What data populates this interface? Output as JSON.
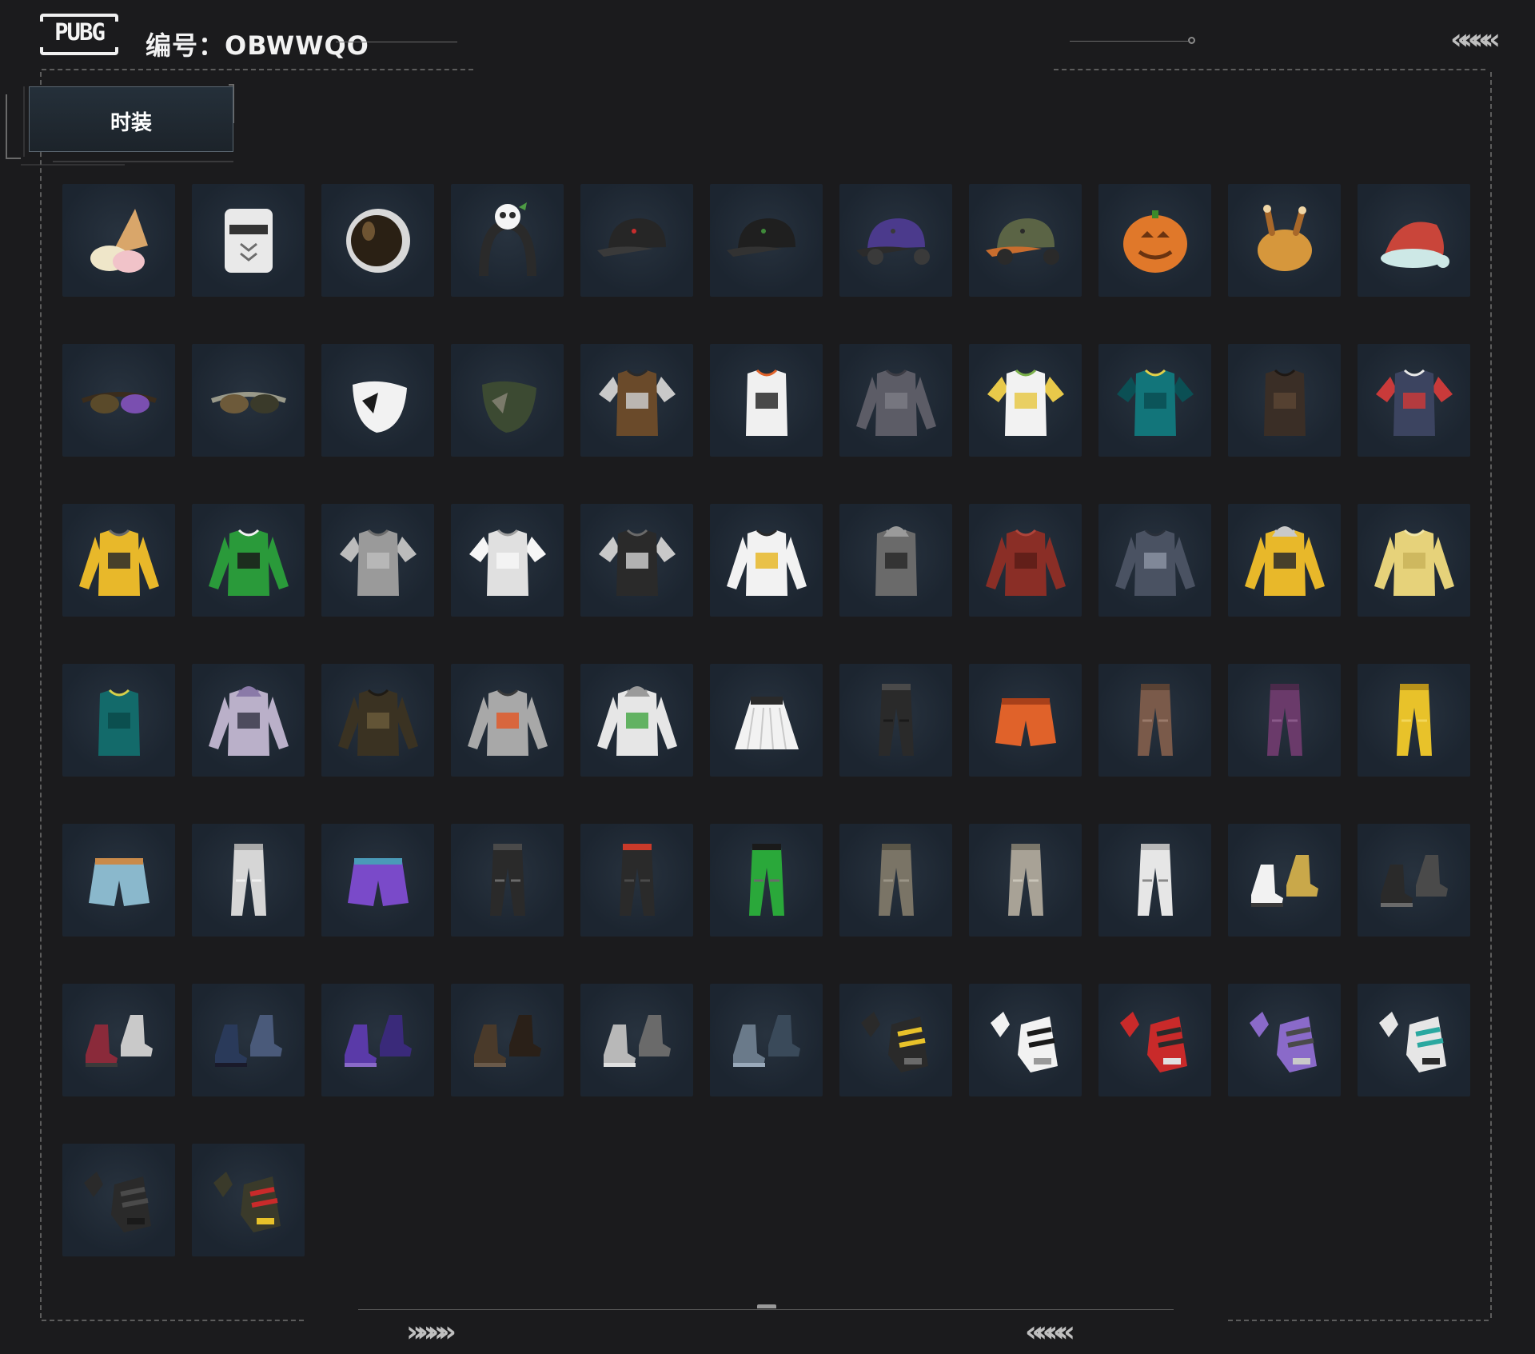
{
  "header": {
    "logo_text": "PUBG",
    "account_label": "编号：OBWWQO"
  },
  "decor": {
    "chevrons_right": "»»»»",
    "chevrons_left": "««««"
  },
  "tabs": [
    {
      "label": "时装",
      "active": true
    }
  ],
  "items": [
    {
      "icon": "ice-cream-hat-icon",
      "colors": [
        "#d9a66a",
        "#f1c3c9",
        "#efe6c9"
      ]
    },
    {
      "icon": "white-helmet-icon",
      "colors": [
        "#e9e9e9",
        "#6c6c6c",
        "#333333"
      ]
    },
    {
      "icon": "astronaut-helmet-icon",
      "colors": [
        "#d8d8d8",
        "#2a2014",
        "#8b6b3e"
      ]
    },
    {
      "icon": "panda-headband-icon",
      "colors": [
        "#2a2a2a",
        "#f5f5f5",
        "#4d9a44"
      ]
    },
    {
      "icon": "black-cap-red-icon",
      "colors": [
        "#262626",
        "#c72d2d",
        "#3a3a3a"
      ]
    },
    {
      "icon": "black-cap-green-icon",
      "colors": [
        "#1f1f1f",
        "#3f8a3a",
        "#323232"
      ]
    },
    {
      "icon": "purple-cap-headset-icon",
      "colors": [
        "#4b3a8c",
        "#3a3a3a",
        "#2b2b2b"
      ]
    },
    {
      "icon": "olive-cap-headset-icon",
      "colors": [
        "#5b6445",
        "#2a2a2a",
        "#c86d2e"
      ]
    },
    {
      "icon": "pumpkin-head-icon",
      "colors": [
        "#e0782a",
        "#6a3310",
        "#3b8a2a"
      ]
    },
    {
      "icon": "roast-chicken-hat-icon",
      "colors": [
        "#d6973c",
        "#a8682a",
        "#f0d6a6"
      ]
    },
    {
      "icon": "santa-hat-icon",
      "colors": [
        "#c9453a",
        "#cde8e6",
        "#e3c170"
      ]
    },
    {
      "icon": "steampunk-goggles-icon",
      "colors": [
        "#5a4a2a",
        "#7a4fb0",
        "#3a2c1c"
      ]
    },
    {
      "icon": "sunglasses-icon",
      "colors": [
        "#6d5a3a",
        "#3a3a2a",
        "#9a9a8a"
      ]
    },
    {
      "icon": "face-mask-icon",
      "colors": [
        "#f2f2f2",
        "#1a1a1a",
        "#b5b5b5"
      ]
    },
    {
      "icon": "camo-bandana-icon",
      "colors": [
        "#3c4a32",
        "#7a7a6a",
        "#2a3224"
      ]
    },
    {
      "icon": "leopard-top-icon",
      "colors": [
        "#6a4a2a",
        "#c9c9c9",
        "#2a2a2a"
      ]
    },
    {
      "icon": "striped-crop-top-icon",
      "colors": [
        "#f0f0f0",
        "#2a2a2a",
        "#e0622a"
      ]
    },
    {
      "icon": "gray-shirt-icon",
      "colors": [
        "#5c5c66",
        "#7a7a84",
        "#3c3c44"
      ]
    },
    {
      "icon": "yellow-white-tee-icon",
      "colors": [
        "#f2f2f2",
        "#e8c94a",
        "#7bb04a"
      ]
    },
    {
      "icon": "teal-polo-icon",
      "colors": [
        "#12757a",
        "#0b4f54",
        "#e0d04a"
      ]
    },
    {
      "icon": "brown-vest-top-icon",
      "colors": [
        "#3a2e26",
        "#5a4434",
        "#1e1814"
      ]
    },
    {
      "icon": "navy-graphic-tee-icon",
      "colors": [
        "#3c4460",
        "#c93a3a",
        "#e8e8e8"
      ]
    },
    {
      "icon": "pubg-striped-jersey-icon",
      "colors": [
        "#e8b82a",
        "#2a2a2a",
        "#6a6a6a"
      ]
    },
    {
      "icon": "green-sport-jersey-icon",
      "colors": [
        "#2a9a3a",
        "#1a1a1a",
        "#f2f2f2"
      ]
    },
    {
      "icon": "gray-tee-icon",
      "colors": [
        "#9a9a9a",
        "#bcbcbc",
        "#6c6c6c"
      ]
    },
    {
      "icon": "white-tee-icon",
      "colors": [
        "#e0e0e0",
        "#f6f6f6",
        "#a0a0a0"
      ]
    },
    {
      "icon": "winner-black-tee-icon",
      "colors": [
        "#2a2a2a",
        "#c9c9c9",
        "#6a6a6a"
      ]
    },
    {
      "icon": "yellow-white-jacket-icon",
      "colors": [
        "#f2f2f2",
        "#e8b82a",
        "#2a2a2a"
      ]
    },
    {
      "icon": "gray-hooded-vest-icon",
      "colors": [
        "#6a6a6a",
        "#2a2a2a",
        "#9a9a9a"
      ]
    },
    {
      "icon": "red-trench-coat-icon",
      "colors": [
        "#8a2e26",
        "#5a1c18",
        "#b0443a"
      ]
    },
    {
      "icon": "denim-jacket-icon",
      "colors": [
        "#4a5262",
        "#8a92a2",
        "#2a303a"
      ]
    },
    {
      "icon": "yellow-hooded-jacket-icon",
      "colors": [
        "#e8b82a",
        "#2a2a2a",
        "#c9c9c9"
      ]
    },
    {
      "icon": "yellow-fuzzy-sweater-icon",
      "colors": [
        "#e6d27a",
        "#c9b45a",
        "#f2e6a6"
      ]
    },
    {
      "icon": "teal-puffer-vest-icon",
      "colors": [
        "#136a6a",
        "#0b4a4a",
        "#d6d04a"
      ]
    },
    {
      "icon": "lavender-hoodie-icon",
      "colors": [
        "#bab0c9",
        "#3a3a4a",
        "#8a7aa8"
      ]
    },
    {
      "icon": "camo-leather-jacket-icon",
      "colors": [
        "#3a3222",
        "#6a5a3a",
        "#1e1a14"
      ]
    },
    {
      "icon": "silver-racing-jacket-icon",
      "colors": [
        "#a8a8a8",
        "#e05a2a",
        "#3a3a3a"
      ]
    },
    {
      "icon": "white-leaf-hoodie-icon",
      "colors": [
        "#e6e6e6",
        "#4aa84a",
        "#9a9a9a"
      ]
    },
    {
      "icon": "white-pleated-skirt-icon",
      "colors": [
        "#f2f2f2",
        "#2a2a2a",
        "#e0c94a"
      ]
    },
    {
      "icon": "black-cargo-pants-icon",
      "colors": [
        "#2a2a2a",
        "#4a4a4a",
        "#1a1a1a"
      ]
    },
    {
      "icon": "orange-shorts-icon",
      "colors": [
        "#e0622a",
        "#a8401a",
        "#f28a4a"
      ]
    },
    {
      "icon": "brown-pants-icon",
      "colors": [
        "#7a5a4a",
        "#5a4234",
        "#9a7a6a"
      ]
    },
    {
      "icon": "purple-pants-icon",
      "colors": [
        "#6a3a6a",
        "#4a2a4a",
        "#8a5a8a"
      ]
    },
    {
      "icon": "yellow-joggers-icon",
      "colors": [
        "#e8c22a",
        "#b8921a",
        "#f2d65a"
      ]
    },
    {
      "icon": "denim-shorts-icon",
      "colors": [
        "#8ab8cc",
        "#c98a4a",
        "#5a8aa0"
      ]
    },
    {
      "icon": "white-joggers-icon",
      "colors": [
        "#d6d6d6",
        "#a8a8a8",
        "#f0f0f0"
      ]
    },
    {
      "icon": "purple-gradient-shorts-icon",
      "colors": [
        "#7a4ac9",
        "#4a9ab8",
        "#5a3a9a"
      ]
    },
    {
      "icon": "black-skinny-pants-icon",
      "colors": [
        "#2a2a2a",
        "#4a4a4a",
        "#6a6a6a"
      ]
    },
    {
      "icon": "black-tactical-pants-icon",
      "colors": [
        "#2a2a2a",
        "#c93a2a",
        "#4a4a4a"
      ]
    },
    {
      "icon": "green-racing-pants-icon",
      "colors": [
        "#2aa83a",
        "#1a1a1a",
        "#6a6a6a"
      ]
    },
    {
      "icon": "khaki-pants-icon",
      "colors": [
        "#7a7466",
        "#5a5648",
        "#9a9486"
      ]
    },
    {
      "icon": "beige-pants-icon",
      "colors": [
        "#a8a296",
        "#7a766a",
        "#c9c4b8"
      ]
    },
    {
      "icon": "white-boots-pants-icon",
      "colors": [
        "#e6e6e6",
        "#b8b8b8",
        "#8a8a8a"
      ]
    },
    {
      "icon": "white-sneakers-icon",
      "colors": [
        "#f2f2f2",
        "#c9a84a",
        "#3a3a3a"
      ]
    },
    {
      "icon": "black-combat-boots-icon",
      "colors": [
        "#2a2a2a",
        "#4a4a4a",
        "#6a6a6a"
      ]
    },
    {
      "icon": "red-high-boots-icon",
      "colors": [
        "#8a2a3a",
        "#c9c9c9",
        "#3a3a3a"
      ]
    },
    {
      "icon": "navy-boots-icon",
      "colors": [
        "#2a3a5a",
        "#4a5a7a",
        "#1a1a2a"
      ]
    },
    {
      "icon": "purple-shoes-icon",
      "colors": [
        "#5a3aa8",
        "#3a2a7a",
        "#8a6ac9"
      ]
    },
    {
      "icon": "brown-work-boots-icon",
      "colors": [
        "#4a3a2a",
        "#2a2018",
        "#6a5a4a"
      ]
    },
    {
      "icon": "silver-ankle-boots-icon",
      "colors": [
        "#b8b8b8",
        "#6a6a6a",
        "#e0e0e0"
      ]
    },
    {
      "icon": "camo-boots-icon",
      "colors": [
        "#6a7a8a",
        "#3a4a5a",
        "#9aaabb"
      ]
    },
    {
      "icon": "yellow-black-gloves-icon",
      "colors": [
        "#2a2a2a",
        "#e8c22a",
        "#6a6a6a"
      ]
    },
    {
      "icon": "panda-gloves-icon",
      "colors": [
        "#f2f2f2",
        "#1a1a1a",
        "#9a9a9a"
      ]
    },
    {
      "icon": "red-racing-gloves-icon",
      "colors": [
        "#c92a2a",
        "#2a2a2a",
        "#e0e0e0"
      ]
    },
    {
      "icon": "purple-gloves-icon",
      "colors": [
        "#8a6ac9",
        "#4a4a4a",
        "#c9c9c9"
      ]
    },
    {
      "icon": "teal-white-gloves-icon",
      "colors": [
        "#e6e6e6",
        "#2aa8a0",
        "#2a2a2a"
      ]
    },
    {
      "icon": "black-fingerless-gloves-icon",
      "colors": [
        "#2a2a2a",
        "#4a4a4a",
        "#1a1a1a"
      ]
    },
    {
      "icon": "hero-logo-gloves-icon",
      "colors": [
        "#3a3a2a",
        "#c92a2a",
        "#e8c22a"
      ]
    }
  ]
}
